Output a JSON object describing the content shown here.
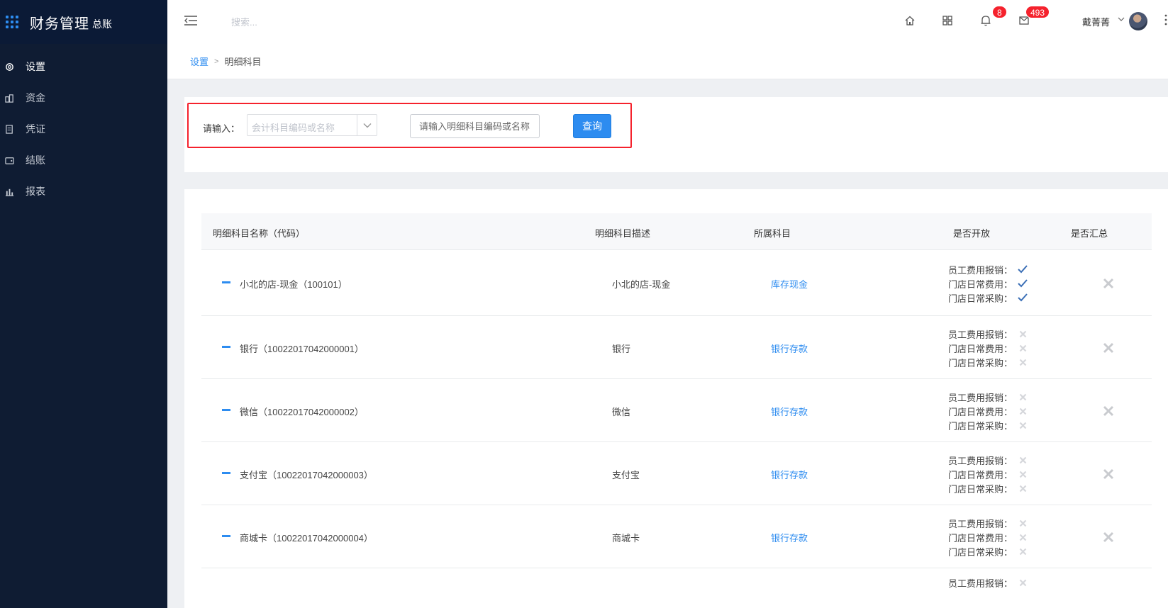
{
  "brand": {
    "title": "财务管理",
    "subtitle": "总账"
  },
  "sidebar": {
    "items": [
      {
        "label": "设置",
        "icon": "gear-icon"
      },
      {
        "label": "资金",
        "icon": "money-icon"
      },
      {
        "label": "凭证",
        "icon": "voucher-icon"
      },
      {
        "label": "结账",
        "icon": "wallet-icon"
      },
      {
        "label": "报表",
        "icon": "bar-chart-icon"
      }
    ]
  },
  "header": {
    "search_placeholder": "搜索...",
    "notifications_count": "8",
    "messages_count": "493",
    "user_name": "戴菁菁"
  },
  "breadcrumb": {
    "parent": "设置",
    "separator": ">",
    "current": "明细科目"
  },
  "filter": {
    "label": "请输入：",
    "select_placeholder": "会计科目编码或名称",
    "input_placeholder": "请输入明细科目编码或名称",
    "query_button": "查询"
  },
  "table": {
    "columns": [
      "明细科目名称（代码）",
      "明细科目描述",
      "所属科目",
      "是否开放",
      "是否汇总"
    ],
    "perm_labels": [
      "员工费用报销：",
      "门店日常费用：",
      "门店日常采购："
    ],
    "rows": [
      {
        "name": "小北的店-现金（100101）",
        "desc": "小北的店-现金",
        "parent": "库存现金",
        "perms": [
          true,
          true,
          true
        ],
        "summary": false
      },
      {
        "name": "银行（10022017042000001）",
        "desc": "银行",
        "parent": "银行存款",
        "perms": [
          false,
          false,
          false
        ],
        "summary": false
      },
      {
        "name": "微信（10022017042000002）",
        "desc": "微信",
        "parent": "银行存款",
        "perms": [
          false,
          false,
          false
        ],
        "summary": false
      },
      {
        "name": "支付宝（10022017042000003）",
        "desc": "支付宝",
        "parent": "银行存款",
        "perms": [
          false,
          false,
          false
        ],
        "summary": false
      },
      {
        "name": "商城卡（10022017042000004）",
        "desc": "商城卡",
        "parent": "银行存款",
        "perms": [
          false,
          false,
          false
        ],
        "summary": false
      },
      {
        "name": "",
        "desc": "",
        "parent": "",
        "perms": [
          false
        ],
        "summary": null
      }
    ]
  },
  "colors": {
    "accent": "#2d8cf0",
    "sidebar": "#0f1c33",
    "highlight_border": "#f5222d",
    "badge": "#f5222d"
  }
}
